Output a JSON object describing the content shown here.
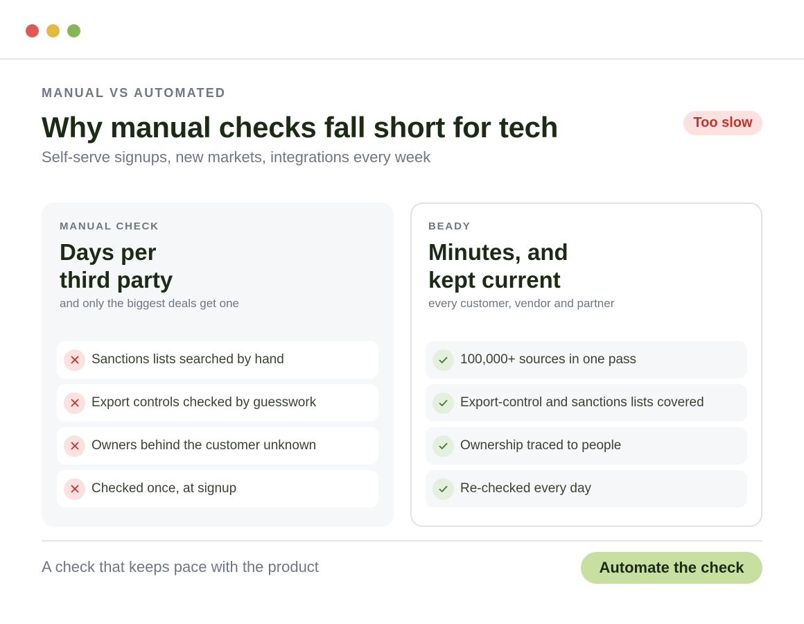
{
  "window": {
    "controls": [
      "close",
      "minimize",
      "zoom"
    ],
    "colors": {
      "close": "#e05a55",
      "minimize": "#e4b941",
      "zoom": "#86b657"
    }
  },
  "header": {
    "eyebrow": "MANUAL VS AUTOMATED",
    "title": "Why manual checks fall short for tech",
    "subtitle": "Self-serve signups, new markets, integrations every week",
    "badge": "Too slow"
  },
  "manual": {
    "label": "MANUAL CHECK",
    "heading_line1": "Days per",
    "heading_line2": "third party",
    "note": "and only the biggest deals get one",
    "items": [
      {
        "icon": "x-icon",
        "text": "Sanctions lists searched by hand"
      },
      {
        "icon": "x-icon",
        "text": "Export controls checked by guesswork"
      },
      {
        "icon": "x-icon",
        "text": "Owners behind the customer unknown"
      },
      {
        "icon": "x-icon",
        "text": "Checked once, at signup"
      }
    ]
  },
  "beady": {
    "label": "BEADY",
    "heading_line1": "Minutes, and",
    "heading_line2": "kept current",
    "note": "every customer, vendor and partner",
    "items": [
      {
        "icon": "check-icon",
        "text": "100,000+ sources in one pass"
      },
      {
        "icon": "check-icon",
        "text": "Export-control and sanctions lists covered"
      },
      {
        "icon": "check-icon",
        "text": "Ownership traced to people"
      },
      {
        "icon": "check-icon",
        "text": "Re-checked every day"
      }
    ]
  },
  "footer": {
    "text": "A check that keeps pace with the product",
    "cta_label": "Automate the check"
  },
  "colors": {
    "accent_green": "#c7e0a2",
    "negative_red": "#c0342c",
    "positive_green": "#3f7a2a",
    "heading": "#1d2a16",
    "muted": "#6f7685"
  }
}
